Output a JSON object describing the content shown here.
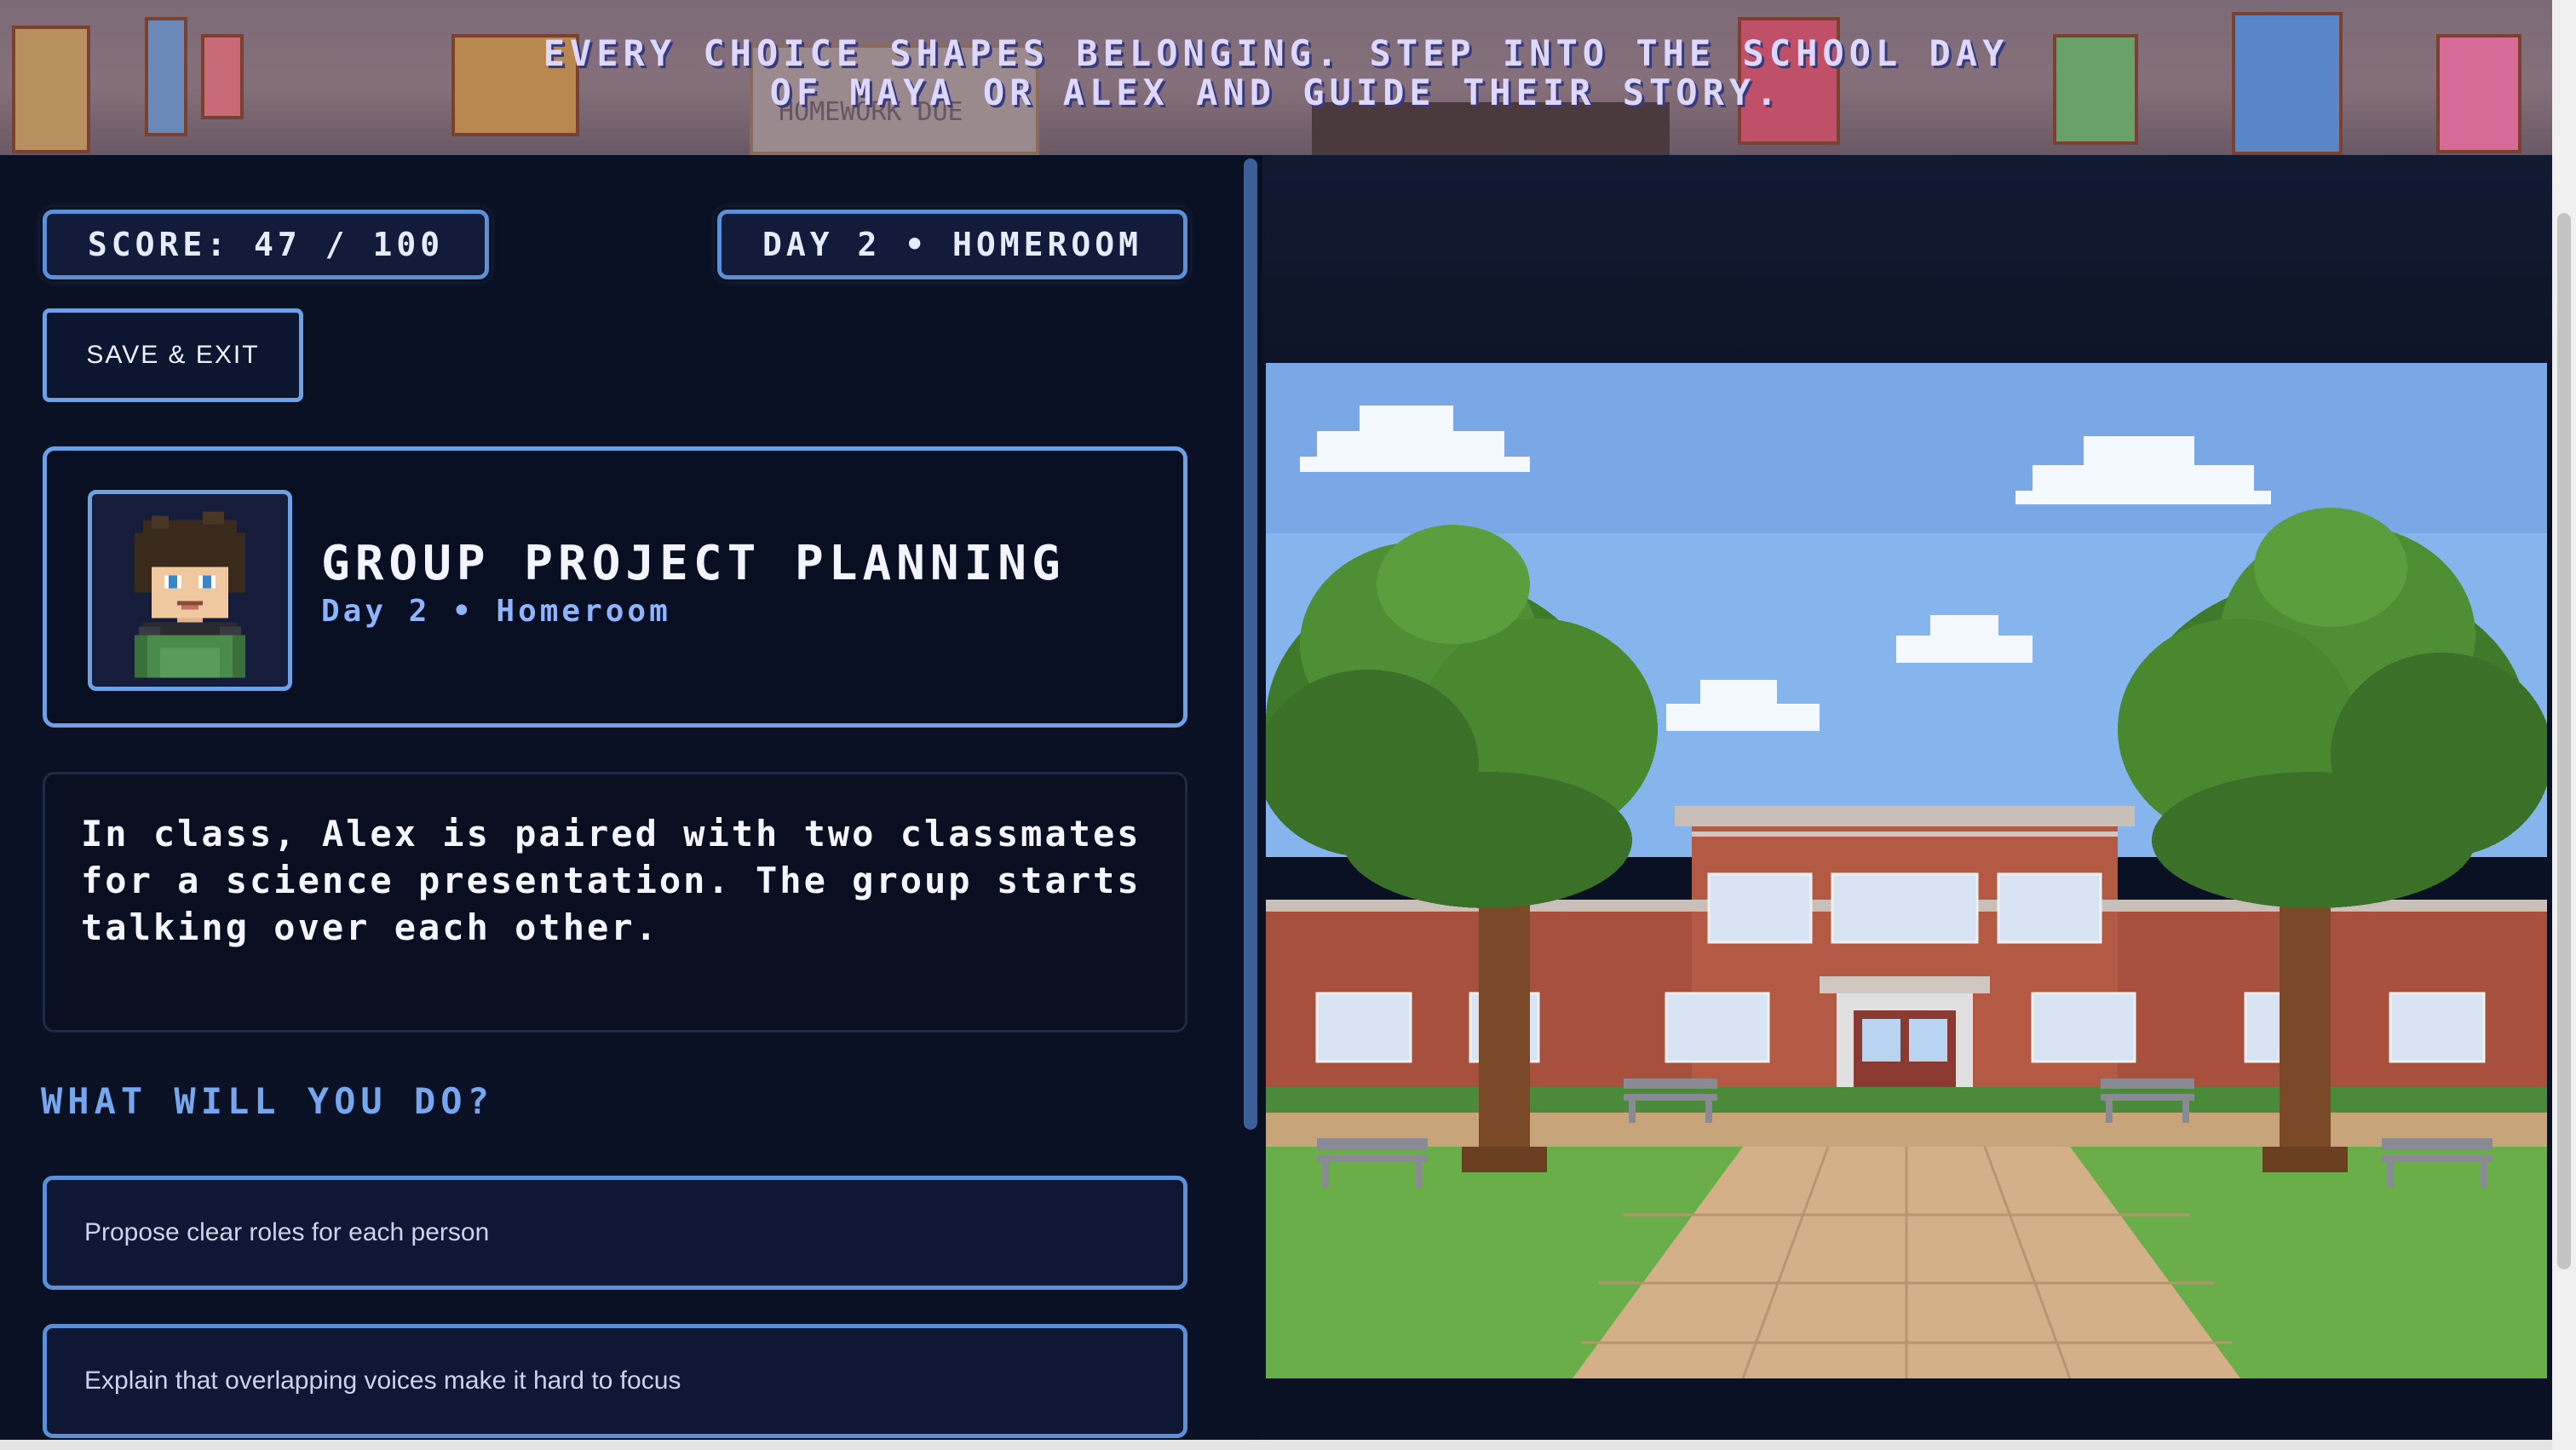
{
  "banner": {
    "line1": "EVERY CHOICE SHAPES BELONGING. STEP INTO THE SCHOOL DAY",
    "line2": "OF MAYA OR ALEX AND GUIDE THEIR STORY.",
    "poster_text": "HOMEWORK DUE"
  },
  "hud": {
    "score": "SCORE: 47 / 100",
    "day": "DAY 2 • HOMEROOM"
  },
  "save_exit_label": "SAVE & EXIT",
  "scene": {
    "title": "GROUP PROJECT PLANNING",
    "subtitle": "Day 2 • Homeroom",
    "character_icon": "alex-portrait"
  },
  "narration": "In class, Alex is paired with two classmates for a science presentation. The group starts talking over each other.",
  "prompt": "WHAT WILL YOU DO?",
  "choices": [
    {
      "label": "Propose clear roles for each person"
    },
    {
      "label": "Explain that overlapping voices make it hard to focus"
    }
  ],
  "colors": {
    "accent": "#6ea0e6",
    "panel_bg": "#0b1124",
    "heading_blue": "#76a7ee",
    "subtitle_blue": "#8fb4ff"
  }
}
